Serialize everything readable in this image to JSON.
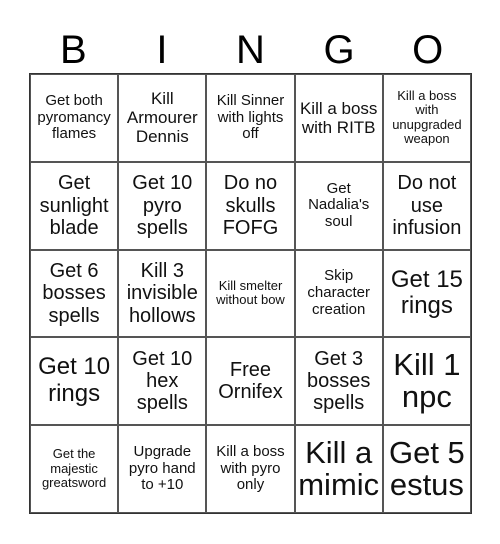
{
  "header": [
    "B",
    "I",
    "N",
    "G",
    "O"
  ],
  "cells": [
    [
      "Get both pyromancy flames",
      "Kill Armourer Dennis",
      "Kill Sinner with lights off",
      "Kill a boss with RITB",
      "Kill a boss with unupgraded weapon"
    ],
    [
      "Get sunlight blade",
      "Get 10 pyro spells",
      "Do no skulls FOFG",
      "Get Nadalia's soul",
      "Do not use infusion"
    ],
    [
      "Get 6 bosses spells",
      "Kill 3 invisible hollows",
      "Kill smelter without bow",
      "Skip character creation",
      "Get 15 rings"
    ],
    [
      "Get 10 rings",
      "Get 10 hex spells",
      "Free Ornifex",
      "Get 3 bosses spells",
      "Kill 1 npc"
    ],
    [
      "Get the majestic greatsword",
      "Upgrade pyro hand to +10",
      "Kill a boss with pyro only",
      "Kill a mimic",
      "Get 5 estus"
    ]
  ]
}
